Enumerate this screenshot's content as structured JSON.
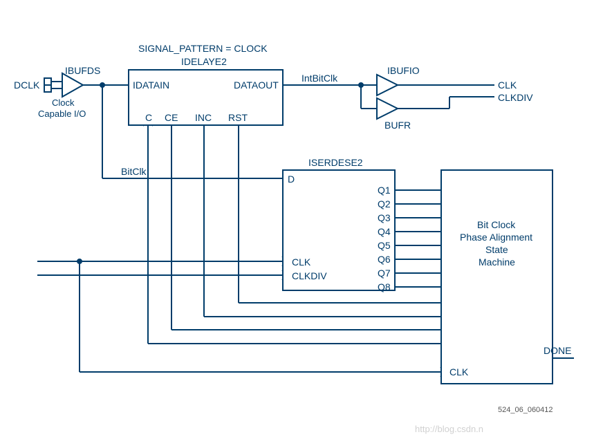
{
  "labels": {
    "signal_pattern": "SIGNAL_PATTERN = CLOCK",
    "idelaye2_title": "IDELAYE2",
    "ibufds": "IBUFDS",
    "dclk": "DCLK",
    "clock_capable_io_1": "Clock",
    "clock_capable_io_2": "Capable I/O",
    "idatain": "IDATAIN",
    "dataout": "DATAOUT",
    "c": "C",
    "ce": "CE",
    "inc": "INC",
    "rst": "RST",
    "intbitclk": "IntBitClk",
    "ibufio": "IBUFIO",
    "bufr": "BUFR",
    "clk_out": "CLK",
    "clkdiv_out": "CLKDIV",
    "bitclk": "BitClk",
    "iserdese2_title": "ISERDESE2",
    "d": "D",
    "clk_in": "CLK",
    "clkdiv_in": "CLKDIV",
    "q1": "Q1",
    "q2": "Q2",
    "q3": "Q3",
    "q4": "Q4",
    "q5": "Q5",
    "q6": "Q6",
    "q7": "Q7",
    "q8": "Q8",
    "sm_line1": "Bit Clock",
    "sm_line2": "Phase Alignment",
    "sm_line3": "State",
    "sm_line4": "Machine",
    "done": "DONE",
    "clk_sm": "CLK",
    "figure_id": "524_06_060412",
    "watermark_blog": "http://blog.csdn.n"
  }
}
